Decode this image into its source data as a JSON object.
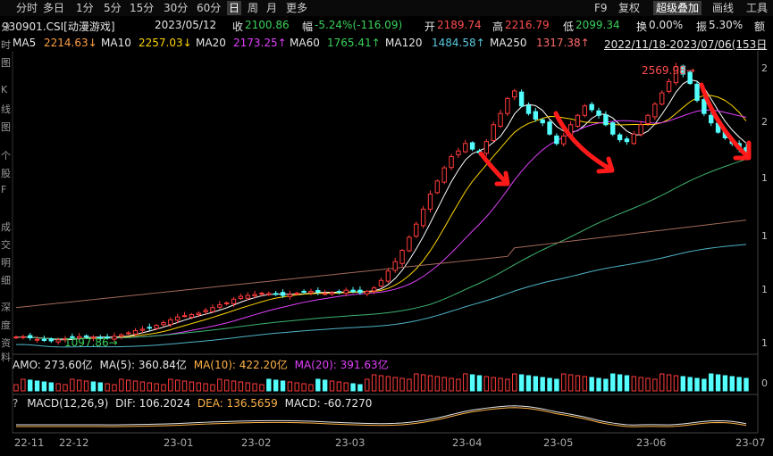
{
  "toolbar": {
    "periods": [
      "分时",
      "多日",
      "1分",
      "5分",
      "15分",
      "30分",
      "60分",
      "日",
      "周",
      "月",
      "更多"
    ],
    "active_period": "日",
    "right_items": [
      "F9",
      "复权",
      "超级叠加",
      "画线",
      "工具"
    ],
    "right_active": "超级叠加"
  },
  "quote": {
    "code": "930901.CSI[动漫游戏]",
    "date": "2023/05/12",
    "close_label": "收",
    "close": "2100.86",
    "change_label": "幅",
    "change": "-5.24%(-116.09)",
    "open_label": "开",
    "open": "2189.74",
    "high_label": "高",
    "high": "2216.79",
    "low_label": "低",
    "low": "2099.34",
    "turnover_label": "换",
    "turnover": "0.00%",
    "amp_label": "振",
    "amp": "5.30%",
    "extra": "额"
  },
  "ma": {
    "ma5_label": "MA5",
    "ma5": "2214.63↓",
    "ma10_label": "MA10",
    "ma10": "2257.03↓",
    "ma20_label": "MA20",
    "ma20": "2173.25↑",
    "ma60_label": "MA60",
    "ma60": "1765.41↑",
    "ma120_label": "MA120",
    "ma120": "1484.58↑",
    "ma250_label": "MA250",
    "ma250": "1317.38↑",
    "range": "2022/11/18-2023/07/06(153日"
  },
  "sidebar_chars": [
    "分",
    "时",
    "图",
    "K",
    "线",
    "图",
    "个",
    "股",
    "F",
    "成",
    "交",
    "明",
    "细",
    "深",
    "度",
    "资",
    "料"
  ],
  "annotations": {
    "high_label": "2569.98→",
    "low_label": "1097.86→"
  },
  "amo": {
    "label": "AMO: 273.60亿",
    "ma5": "MA(5): 360.84亿",
    "ma10": "MA(10): 422.20亿",
    "ma20": "MA(20): 391.63亿"
  },
  "macd": {
    "q": "?",
    "label": "MACD(12,26,9)",
    "dif": "DIF: 106.2024",
    "dea": "DEA: 136.5659",
    "macd": "MACD: -60.7270"
  },
  "right_axis": [
    "2",
    "2",
    "1",
    "1",
    "1",
    "1",
    "0"
  ],
  "x_axis": [
    "22-11",
    "22-12",
    "23-01",
    "23-02",
    "23-03",
    "23-04",
    "23-05",
    "23-06",
    "23-07"
  ],
  "colors": {
    "up": "#ff3b3b",
    "down": "#54ffff",
    "ma5": "#ffffff",
    "ma10": "#ffd700",
    "ma20": "#e040fb",
    "ma60": "#3cb371",
    "ma120": "#4fb3c8",
    "ma250": "#a36a5a",
    "arrow": "#ff1a1a"
  },
  "chart_data": {
    "type": "candlestick",
    "close_path": [
      1118,
      1120,
      1114,
      1106,
      1100,
      1098,
      1103,
      1110,
      1116,
      1120,
      1123,
      1118,
      1112,
      1115,
      1122,
      1130,
      1140,
      1152,
      1160,
      1168,
      1180,
      1195,
      1210,
      1225,
      1232,
      1238,
      1245,
      1260,
      1275,
      1290,
      1300,
      1320,
      1335,
      1340,
      1345,
      1352,
      1350,
      1348,
      1340,
      1345,
      1352,
      1358,
      1362,
      1358,
      1350,
      1355,
      1360,
      1368,
      1360,
      1355,
      1362,
      1380,
      1420,
      1470,
      1520,
      1580,
      1650,
      1720,
      1800,
      1880,
      1950,
      2020,
      2080,
      2110,
      2150,
      2120,
      2100,
      2160,
      2250,
      2310,
      2390,
      2430,
      2350,
      2310,
      2280,
      2260,
      2200,
      2150,
      2190,
      2250,
      2300,
      2350,
      2330,
      2300,
      2250,
      2200,
      2170,
      2160,
      2200,
      2250,
      2300,
      2360,
      2420,
      2480,
      2560,
      2520,
      2470,
      2380,
      2310,
      2260,
      2210,
      2180,
      2150,
      2120,
      2100
    ]
  }
}
